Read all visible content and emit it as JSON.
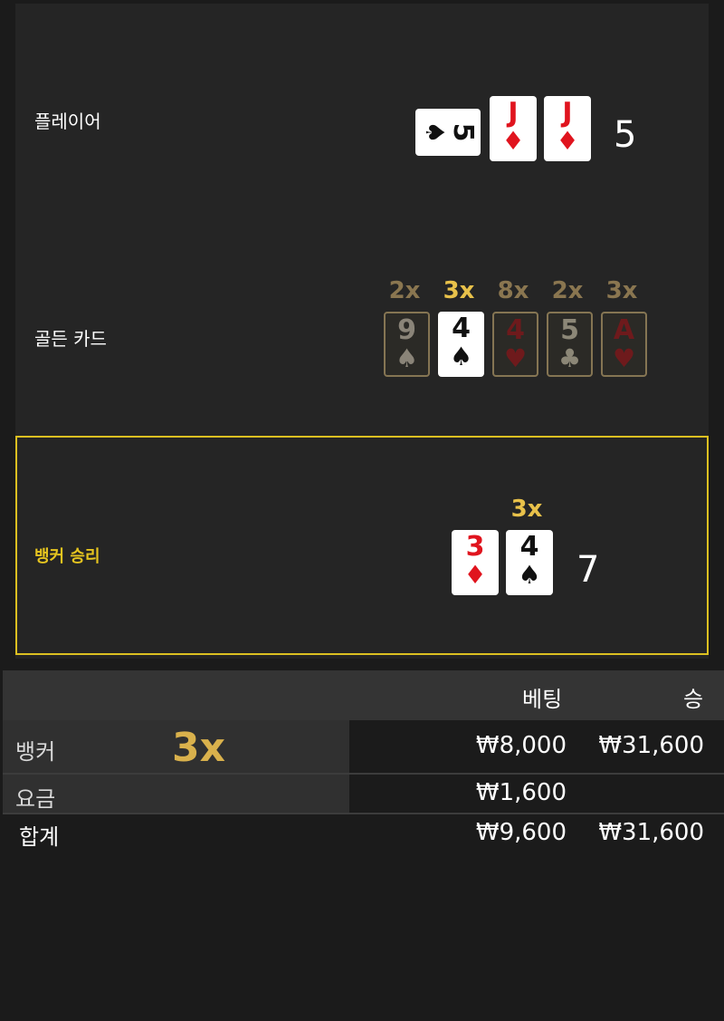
{
  "player": {
    "label": "플레이어",
    "cards": [
      {
        "rank": "5",
        "suit": "♠",
        "color": "black"
      },
      {
        "rank": "J",
        "suit": "♦",
        "color": "red"
      },
      {
        "rank": "J",
        "suit": "♦",
        "color": "red"
      }
    ],
    "score": "5"
  },
  "golden": {
    "label": "골든 카드",
    "cards": [
      {
        "rank": "9",
        "suit": "♠",
        "mult": "2x",
        "active": false
      },
      {
        "rank": "4",
        "suit": "♠",
        "mult": "3x",
        "active": true
      },
      {
        "rank": "4",
        "suit": "♥",
        "mult": "8x",
        "active": false
      },
      {
        "rank": "5",
        "suit": "♣",
        "mult": "2x",
        "active": false
      },
      {
        "rank": "A",
        "suit": "♥",
        "mult": "3x",
        "active": false
      }
    ]
  },
  "banker": {
    "label": "뱅커 승리",
    "mult": "3x",
    "cards": [
      {
        "rank": "3",
        "suit": "♦",
        "color": "red"
      },
      {
        "rank": "4",
        "suit": "♠",
        "color": "black"
      }
    ],
    "score": "7"
  },
  "table": {
    "headers": {
      "bet": "베팅",
      "win": "승"
    },
    "rows": [
      {
        "label": "뱅커",
        "mult": "3x",
        "bet": "₩8,000",
        "win": "₩31,600"
      },
      {
        "label": "요금",
        "bet": "₩1,600",
        "win": ""
      },
      {
        "label": "합계",
        "bet": "₩9,600",
        "win": "₩31,600"
      }
    ]
  },
  "colors": {
    "accent": "#dcc021",
    "gold": "#e8c14a",
    "red": "#e0141e"
  }
}
